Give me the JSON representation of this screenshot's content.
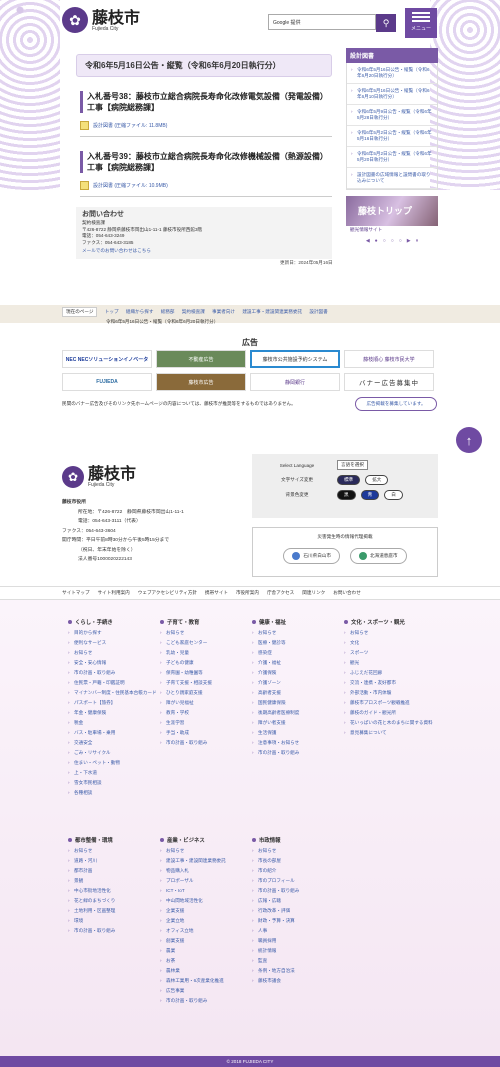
{
  "header": {
    "logo_jp": "藤枝市",
    "logo_en": "Fujieda City",
    "search_placeholder": "Google 提供",
    "menu_label": "メニュー"
  },
  "main": {
    "title": "令和6年5月16日公告・縦覧（令和6年6月20日執行分）",
    "bids": [
      {
        "title": "入札番号38：藤枝市立総合病院長寿命化改修電気設備（発電設備）工事【病院総務課】",
        "pdf": "設計図書 (圧縮ファイル: 11.8MB)"
      },
      {
        "title": "入札番号39：藤枝市立総合病院長寿命化改修機械設備（熱源設備）工事【病院総務課】",
        "pdf": "設計図書 (圧縮ファイル: 10.9MB)"
      }
    ],
    "contact": {
      "heading": "お問い合わせ",
      "dept": "契約検査課",
      "address": "〒426-8722 静岡県藤枝市岡出山1-11-1 藤枝市役所西館3階",
      "tel": "電話：054-643-3249",
      "fax": "ファクス：054-643-3185",
      "mail": "メールでのお問い合わせはこちら"
    },
    "updated": "更新日：2024年05月16日"
  },
  "sidebar": {
    "heading": "設計図書",
    "items": [
      "令和6年5月16日公告・縦覧（令和6年6月20日執行分）",
      "令和6年5月16日公告・縦覧（令和6年6月10日執行分）",
      "令和6年5月9日公告・縦覧（令和6年5月28日執行分）",
      "令和6年5月2日公告・縦覧（令和6年5月16日執行分）",
      "令和6年5月2日公告・縦覧（令和6年5月20日執行分）",
      "設計図書の広域情報と設問書の取り込みについて"
    ],
    "banner_title": "藤枝トリップ",
    "banner_sub": "観光情報サイト"
  },
  "breadcrumb": {
    "label": "現在のページ",
    "items": [
      "トップ",
      "組織から探す",
      "総務部",
      "契約検査課",
      "事業者向け",
      "建設工事・建設関連業務委託",
      "設計図書",
      "令和6年5月16日公告・縦覧（令和6年6月20日執行分）"
    ]
  },
  "ads": {
    "heading": "広告",
    "items": [
      "NEC NECソリューションイノベータ",
      "不動産広告",
      "藤枝市公共施設予約システム",
      "藤枝順心 藤枝市民大学",
      "FUJIEDA",
      "藤枝市広告",
      "静岡銀行",
      "バナー広告募集中"
    ],
    "note": "民間のバナー広告及びそのリンク先ホームページの内容については、藤枝市が推奨等をするものではありません。",
    "recruit": "広告掲載を募集しています。"
  },
  "footer": {
    "logo_jp": "藤枝市",
    "logo_en": "Fujieda City",
    "office": "藤枝市役所",
    "addr": "所在地：〒426-8722　静岡県藤枝市岡出山1-11-1",
    "tel": "電話：054-643-3111（代表）",
    "fax": "ファクス：054-643-3604",
    "hours": "開庁時間：平日午前8時30分から午後5時15分まで",
    "hours2": "（祝日、年末年始を除く）",
    "corp": "法人番号1000020222143",
    "lang_label": "Select Language",
    "lang_value": "言語を選択",
    "size_label": "文字サイズ変更",
    "size_std": "標準",
    "size_big": "拡大",
    "bg_label": "背景色変更",
    "bg_black": "黒",
    "bg_blue": "青",
    "bg_white": "白",
    "disaster_title": "災害発生時の情報代理掲載",
    "city1": "石川県白山市",
    "city2": "北海道恵庭市",
    "links": [
      "サイトマップ",
      "サイト利用案内",
      "ウェブアクセシビリティ方針",
      "携帯サイト",
      "市役所案内",
      "庁舎アクセス",
      "関連リンク",
      "お問い合わせ"
    ],
    "copyright": "© 2018 FUJIEDA CITY"
  },
  "categories": [
    {
      "title": "くらし・手続き",
      "items": [
        "目的から探す",
        "便利なサービス",
        "お知らせ",
        "安全・安心情報",
        "市の計画・取り組み",
        "住民票・戸籍・印鑑証明",
        "マイナンバー制度・住民基本台帳カード",
        "パスポート【旅券】",
        "年金・健康保険",
        "税金",
        "バス・駐車場・乗用",
        "交通安全",
        "ごみ・リサイクル",
        "住まい・ペット・動物",
        "上・下水道",
        "雪女市民相談",
        "各種相談"
      ]
    },
    {
      "title": "子育て・教育",
      "items": [
        "お知らせ",
        "こども家庭センター",
        "乳幼・児童",
        "子どもの健康",
        "保育園・幼稚園等",
        "子育て支援・相談支援",
        "ひとり親家庭支援",
        "障がい児福祉",
        "教育・学校",
        "生涯学習",
        "手当・助成",
        "市の計画・取り組み"
      ]
    },
    {
      "title": "健康・福祉",
      "items": [
        "お知らせ",
        "医療・健診等",
        "感染症",
        "介護・福祉",
        "介護保険",
        "介護ゾーン",
        "高齢者支援",
        "国民健康保険",
        "後期高齢者医療制度",
        "障がい者支援",
        "生活保護",
        "注意事項・お知らせ",
        "市の計画・取り組み"
      ]
    },
    {
      "title": "文化・スポーツ・観光",
      "items": [
        "お知らせ",
        "文化",
        "スポーツ",
        "観光",
        "ふじえだ花回廊",
        "交流・連携・友好都市",
        "外部活動・市内体験",
        "藤枝市プロスポーツ観戦推進",
        "藤枝のガイド・観光所",
        "花いっぱいの花と木のまちに関する資料",
        "意見募集について"
      ]
    },
    {
      "title": "都市整備・環境",
      "items": [
        "お知らせ",
        "道路・河川",
        "都市計画",
        "景観",
        "中心市街地活性化",
        "花と緑のまちづくり",
        "土地利用・区画整理",
        "環境",
        "市の計画・取り組み"
      ]
    },
    {
      "title": "産業・ビジネス",
      "items": [
        "お知らせ",
        "建設工事・建設関連業務委託",
        "物品購入札",
        "プロポーザル",
        "ICT・IoT",
        "中山間地域活性化",
        "企業支援",
        "企業立地",
        "オフィス立地",
        "創業支援",
        "農業",
        "お茶",
        "農林業",
        "森林工業用・6次産業化推進",
        "広告事業",
        "市の計画・取り組み"
      ]
    },
    {
      "title": "市政情報",
      "items": [
        "お知らせ",
        "市長の部屋",
        "市の紹介",
        "市のプロフィール",
        "市の計画・取り組み",
        "広報・広聴",
        "行政改革・評価",
        "財政・予算・決算",
        "人事",
        "職員採用",
        "統計情報",
        "監査",
        "条例・地方自治法",
        "藤枝市議会"
      ]
    }
  ]
}
